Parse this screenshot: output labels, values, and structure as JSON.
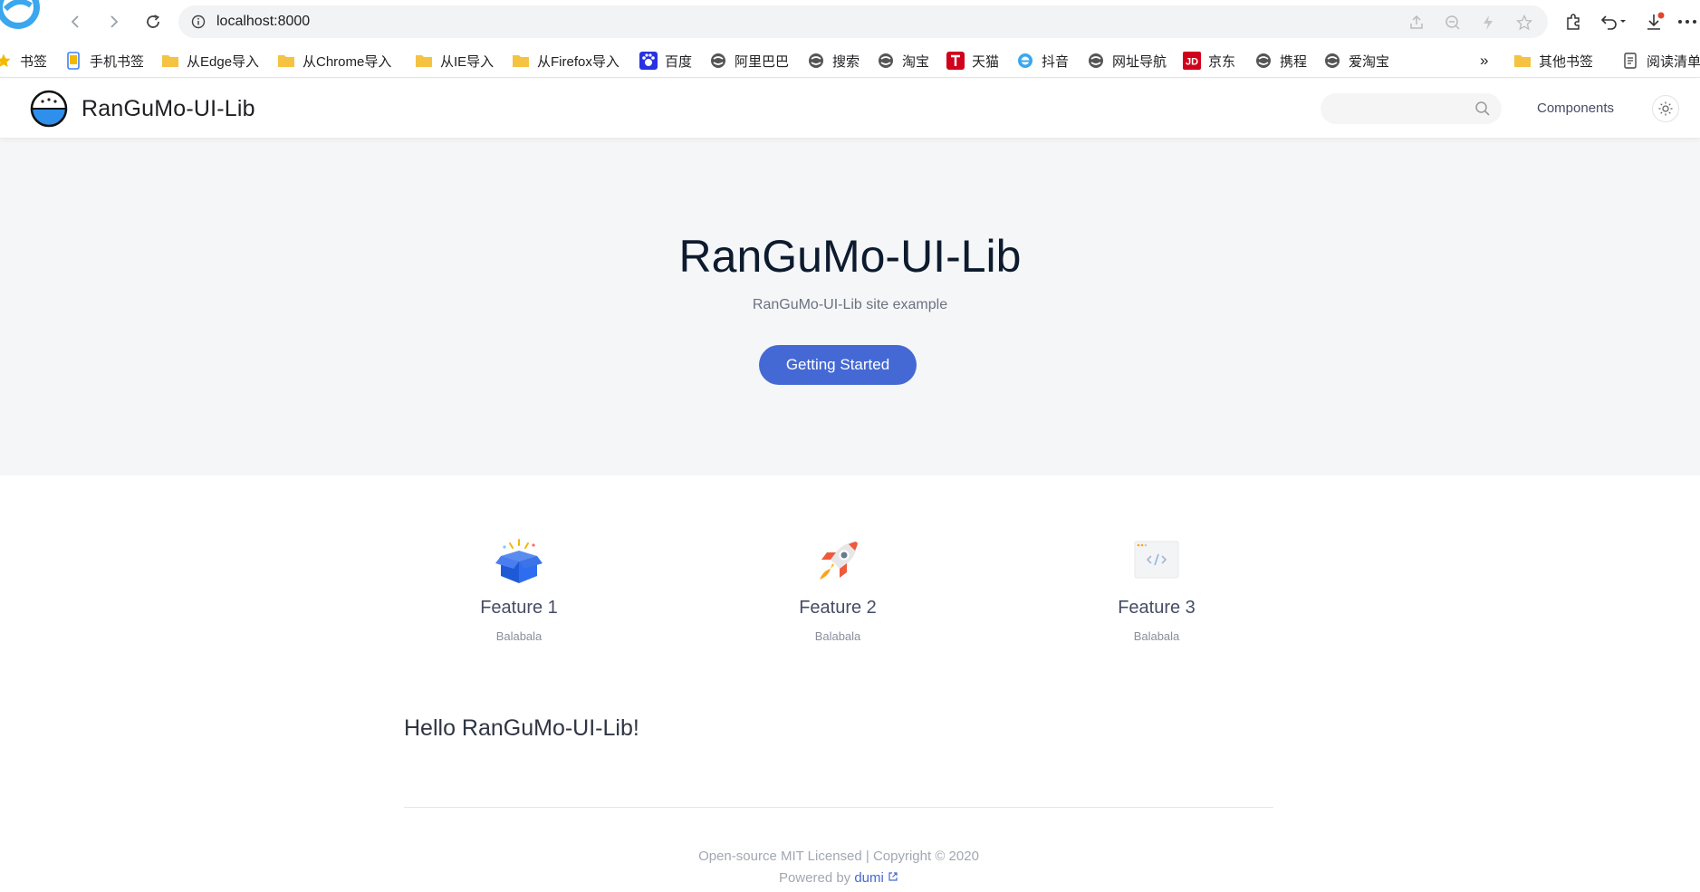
{
  "browser": {
    "url": "localhost:8000",
    "bookmarks": [
      {
        "label": "书签",
        "icon": "star-icon"
      },
      {
        "label": "手机书签",
        "icon": "phone-icon"
      },
      {
        "label": "从Edge导入",
        "icon": "folder-icon"
      },
      {
        "label": "从Chrome导入",
        "icon": "folder-icon"
      },
      {
        "label": "从IE导入",
        "icon": "folder-icon"
      },
      {
        "label": "从Firefox导入",
        "icon": "folder-icon"
      },
      {
        "label": "百度",
        "icon": "baidu-icon"
      },
      {
        "label": "阿里巴巴",
        "icon": "globe-icon"
      },
      {
        "label": "搜索",
        "icon": "globe-icon"
      },
      {
        "label": "淘宝",
        "icon": "globe-icon"
      },
      {
        "label": "天猫",
        "icon": "tmall-icon"
      },
      {
        "label": "抖音",
        "icon": "browser-e-icon"
      },
      {
        "label": "网址导航",
        "icon": "globe-icon"
      },
      {
        "label": "京东",
        "icon": "jd-icon"
      },
      {
        "label": "携程",
        "icon": "globe-icon"
      },
      {
        "label": "爱淘宝",
        "icon": "globe-icon"
      }
    ],
    "overflow_label": "»",
    "other_bookmarks": "其他书签",
    "reading_list": "阅读清单"
  },
  "site": {
    "name": "RanGuMo-UI-Lib",
    "nav_components": "Components",
    "search_placeholder": ""
  },
  "hero": {
    "title": "RanGuMo-UI-Lib",
    "description": "RanGuMo-UI-Lib site example",
    "button_label": "Getting Started"
  },
  "features": [
    {
      "title": "Feature 1",
      "description": "Balabala",
      "icon": "gift-box-icon"
    },
    {
      "title": "Feature 2",
      "description": "Balabala",
      "icon": "rocket-icon"
    },
    {
      "title": "Feature 3",
      "description": "Balabala",
      "icon": "code-window-icon"
    }
  ],
  "content": {
    "hello": "Hello RanGuMo-UI-Lib!"
  },
  "footer": {
    "license": "Open-source MIT Licensed | Copyright © 2020",
    "powered_by": "Powered by",
    "powered_link": "dumi"
  },
  "colors": {
    "accent": "#4569d4",
    "hero_bg": "#f5f6f8"
  }
}
